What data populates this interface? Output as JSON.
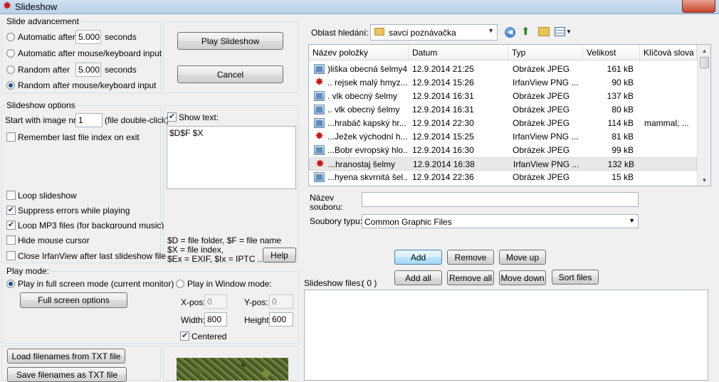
{
  "window": {
    "title": "Slideshow",
    "bg_hint": "IrfanView"
  },
  "advancement": {
    "legend": "Slide advancement",
    "auto_label": "Automatic after",
    "auto_value": "5.000",
    "auto_unit": "seconds",
    "auto_mouse_label": "Automatic after mouse/keyboard input",
    "random_label": "Random",
    "random_after": "after",
    "random_value": "5.000",
    "random_unit": "seconds",
    "random_mouse_label": "Random",
    "random_mouse_tail": "after mouse/keyboard input",
    "selected": "random_mouse"
  },
  "actions": {
    "play": "Play Slideshow",
    "cancel": "Cancel"
  },
  "options": {
    "legend": "Slideshow options",
    "start_label": "Start with image nr.:",
    "start_value": "1",
    "start_hint": "(file double-click)",
    "remember_label": "Remember last file index on exit",
    "show_text_label": "Show text:",
    "show_text_value": "$D$F $X",
    "loop_label": "Loop slideshow",
    "suppress_label": "Suppress errors while playing",
    "loop_mp3_label": "Loop MP3 files (for background music)",
    "hide_mouse_label": "Hide mouse cursor",
    "close_label": "Close IrfanView after last slideshow file",
    "help_text_1": "$D = file folder, $F = file name",
    "help_text_2": "$X = file index,",
    "help_text_3": "$Ex = EXIF, $Ix = IPTC ...",
    "help_button": "Help"
  },
  "playmode": {
    "legend": "Play mode:",
    "fullscreen_label": "Play in full screen mode (current monitor)",
    "fullscreen_options": "Full screen options",
    "window_label": "Play in Window mode:",
    "xpos_label": "X-pos:",
    "xpos_value": "0",
    "ypos_label": "Y-pos:",
    "ypos_value": "0",
    "width_label": "Width:",
    "width_value": "800",
    "height_label": "Height:",
    "height_value": "600",
    "centered_label": "Centered"
  },
  "bottom": {
    "load_txt": "Load filenames from TXT file",
    "save_txt": "Save filenames as TXT file"
  },
  "browser": {
    "lookin_label": "Oblast hledání:",
    "lookin_value": "savci poznávačka",
    "columns": [
      "Název položky",
      "Datum",
      "Typ",
      "Velikost",
      "Klíčová slova"
    ],
    "rows": [
      {
        "name": ")liška obecná šelmy4",
        "date": "12.9.2014 21:25",
        "type": "Obrázek JPEG",
        "size": "161 kB",
        "kw": "",
        "icon": "jpg"
      },
      {
        "name": ".. rejsek malý hmyz...",
        "date": "12.9.2014 15:26",
        "type": "IrfanView PNG ...",
        "size": "90 kB",
        "kw": "",
        "icon": "png"
      },
      {
        "name": ". vlk obecný šelmy",
        "date": "12.9.2014 16:31",
        "type": "Obrázek JPEG",
        "size": "137 kB",
        "kw": "",
        "icon": "jpg"
      },
      {
        "name": ".. vlk obecný šelmy",
        "date": "12.9.2014 16:31",
        "type": "Obrázek JPEG",
        "size": "80 kB",
        "kw": "",
        "icon": "jpg"
      },
      {
        "name": "...hrabáč kapský hr...",
        "date": "12.9.2014 22:30",
        "type": "Obrázek JPEG",
        "size": "114 kB",
        "kw": "mammal; ...",
        "icon": "jpg"
      },
      {
        "name": "...Ježek východní h...",
        "date": "12.9.2014 15:25",
        "type": "IrfanView PNG ...",
        "size": "81 kB",
        "kw": "",
        "icon": "png"
      },
      {
        "name": "...Bobr evropský hlo...",
        "date": "12.9.2014 16:30",
        "type": "Obrázek JPEG",
        "size": "99 kB",
        "kw": "",
        "icon": "jpg"
      },
      {
        "name": "...hranostaj šelmy",
        "date": "12.9.2014 16:38",
        "type": "IrfanView PNG ...",
        "size": "132 kB",
        "kw": "",
        "icon": "png"
      },
      {
        "name": "...hyena skvrnitá šel...",
        "date": "12.9.2014 22:36",
        "type": "Obrázek JPEG",
        "size": "15 kB",
        "kw": "",
        "icon": "jpg"
      }
    ],
    "selected_row": 7,
    "filename_label": "Název souboru:",
    "filename_value": "",
    "filetype_label": "Soubory typu:",
    "filetype_value": "Common Graphic Files"
  },
  "filelist": {
    "add": "Add",
    "remove": "Remove",
    "move_up": "Move up",
    "add_all": "Add all",
    "remove_all": "Remove all",
    "move_down": "Move down",
    "sort": "Sort files",
    "label": "Slideshow files:",
    "count": "( 0 )"
  }
}
